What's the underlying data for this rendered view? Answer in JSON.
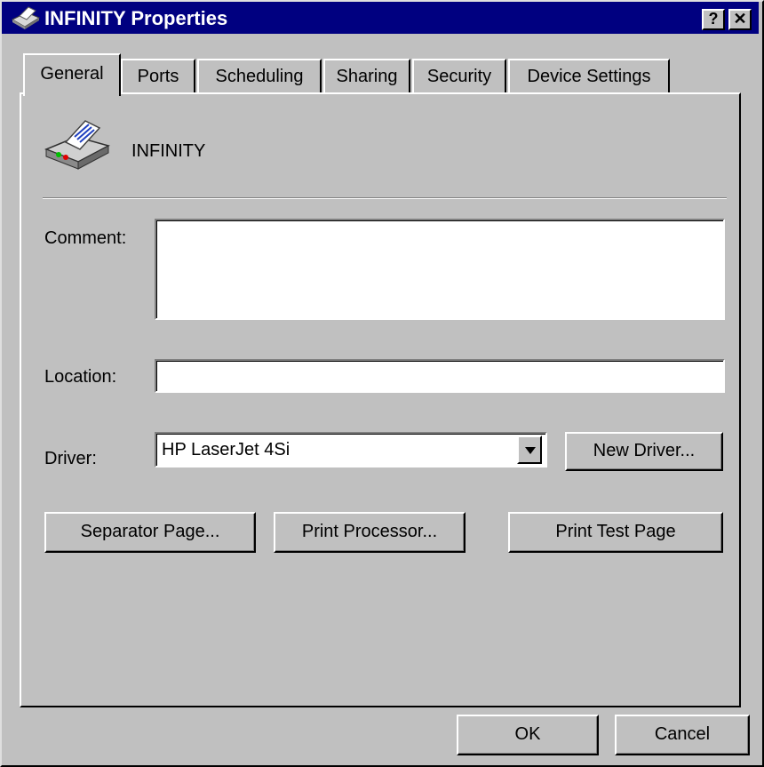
{
  "window": {
    "title": "INFINITY Properties",
    "help_glyph": "?",
    "close_glyph": "✕"
  },
  "tabs": [
    {
      "label": "General",
      "active": true
    },
    {
      "label": "Ports",
      "active": false
    },
    {
      "label": "Scheduling",
      "active": false
    },
    {
      "label": "Sharing",
      "active": false
    },
    {
      "label": "Security",
      "active": false
    },
    {
      "label": "Device Settings",
      "active": false
    }
  ],
  "printer": {
    "icon": "printer-icon",
    "name": "INFINITY"
  },
  "form": {
    "comment_label": "Comment:",
    "comment_value": "",
    "location_label": "Location:",
    "location_value": "",
    "driver_label": "Driver:",
    "driver_value": "HP LaserJet 4Si",
    "new_driver_label": "New Driver..."
  },
  "buttons": {
    "separator_page": "Separator Page...",
    "print_processor": "Print Processor...",
    "print_test_page": "Print Test Page",
    "ok": "OK",
    "cancel": "Cancel"
  },
  "colors": {
    "titlebar": "#000080",
    "face": "#c0c0c0"
  }
}
